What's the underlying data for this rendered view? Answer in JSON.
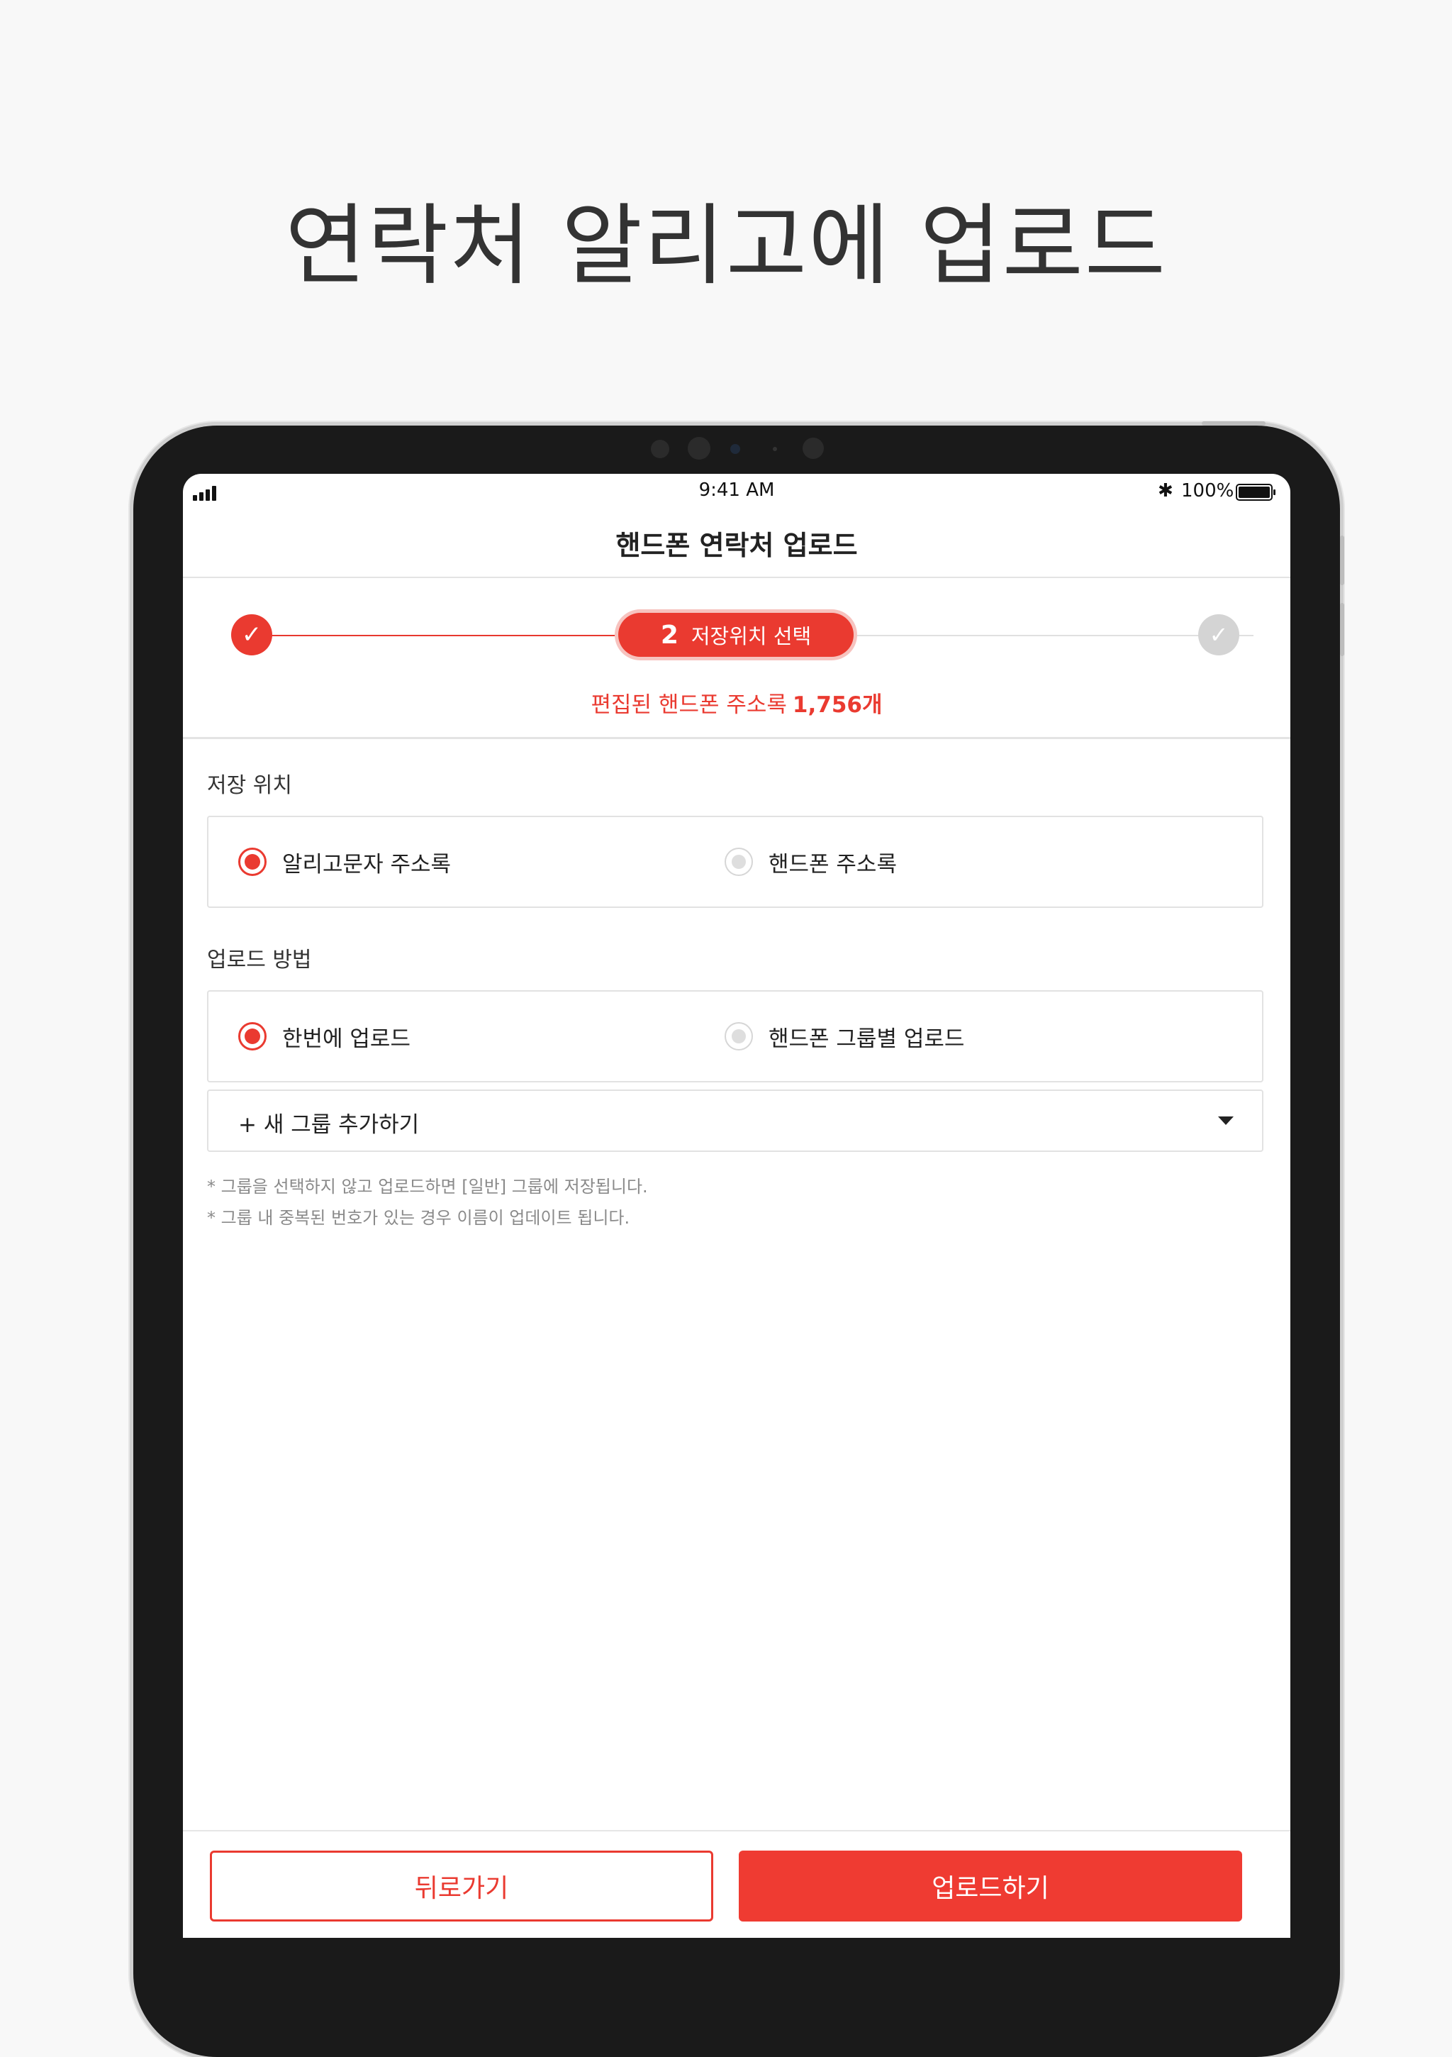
{
  "promo": {
    "title": "연락처 알리고에 업로드"
  },
  "status_bar": {
    "time": "9:41 AM",
    "bluetooth": "✱",
    "battery": "100%"
  },
  "nav": {
    "title": "핸드폰 연락처 업로드"
  },
  "stepper": {
    "done_icon": "check-icon",
    "current_number": "2",
    "current_label": "저장위치 선택",
    "future_icon": "check-icon"
  },
  "summary": {
    "label": "편집된 핸드폰 주소록",
    "count": "1,756개"
  },
  "storage": {
    "label": "저장 위치",
    "options": [
      {
        "label": "알리고문자 주소록",
        "selected": true
      },
      {
        "label": "핸드폰 주소록",
        "selected": false
      }
    ]
  },
  "method": {
    "label": "업로드 방법",
    "options": [
      {
        "label": "한번에 업로드",
        "selected": true
      },
      {
        "label": "핸드폰 그룹별 업로드",
        "selected": false
      }
    ]
  },
  "group_select": {
    "value": "+ 새 그룹 추가하기"
  },
  "notes": [
    "* 그룹을 선택하지 않고 업로드하면 [일반] 그룹에 저장됩니다.",
    "* 그룹 내 중복된 번호가 있는 경우 이름이 업데이트 됩니다."
  ],
  "actions": {
    "back": "뒤로가기",
    "upload": "업로드하기"
  },
  "colors": {
    "accent": "#ea3a30",
    "frame": "#1a1a1a",
    "background": "#f8f8f8"
  }
}
